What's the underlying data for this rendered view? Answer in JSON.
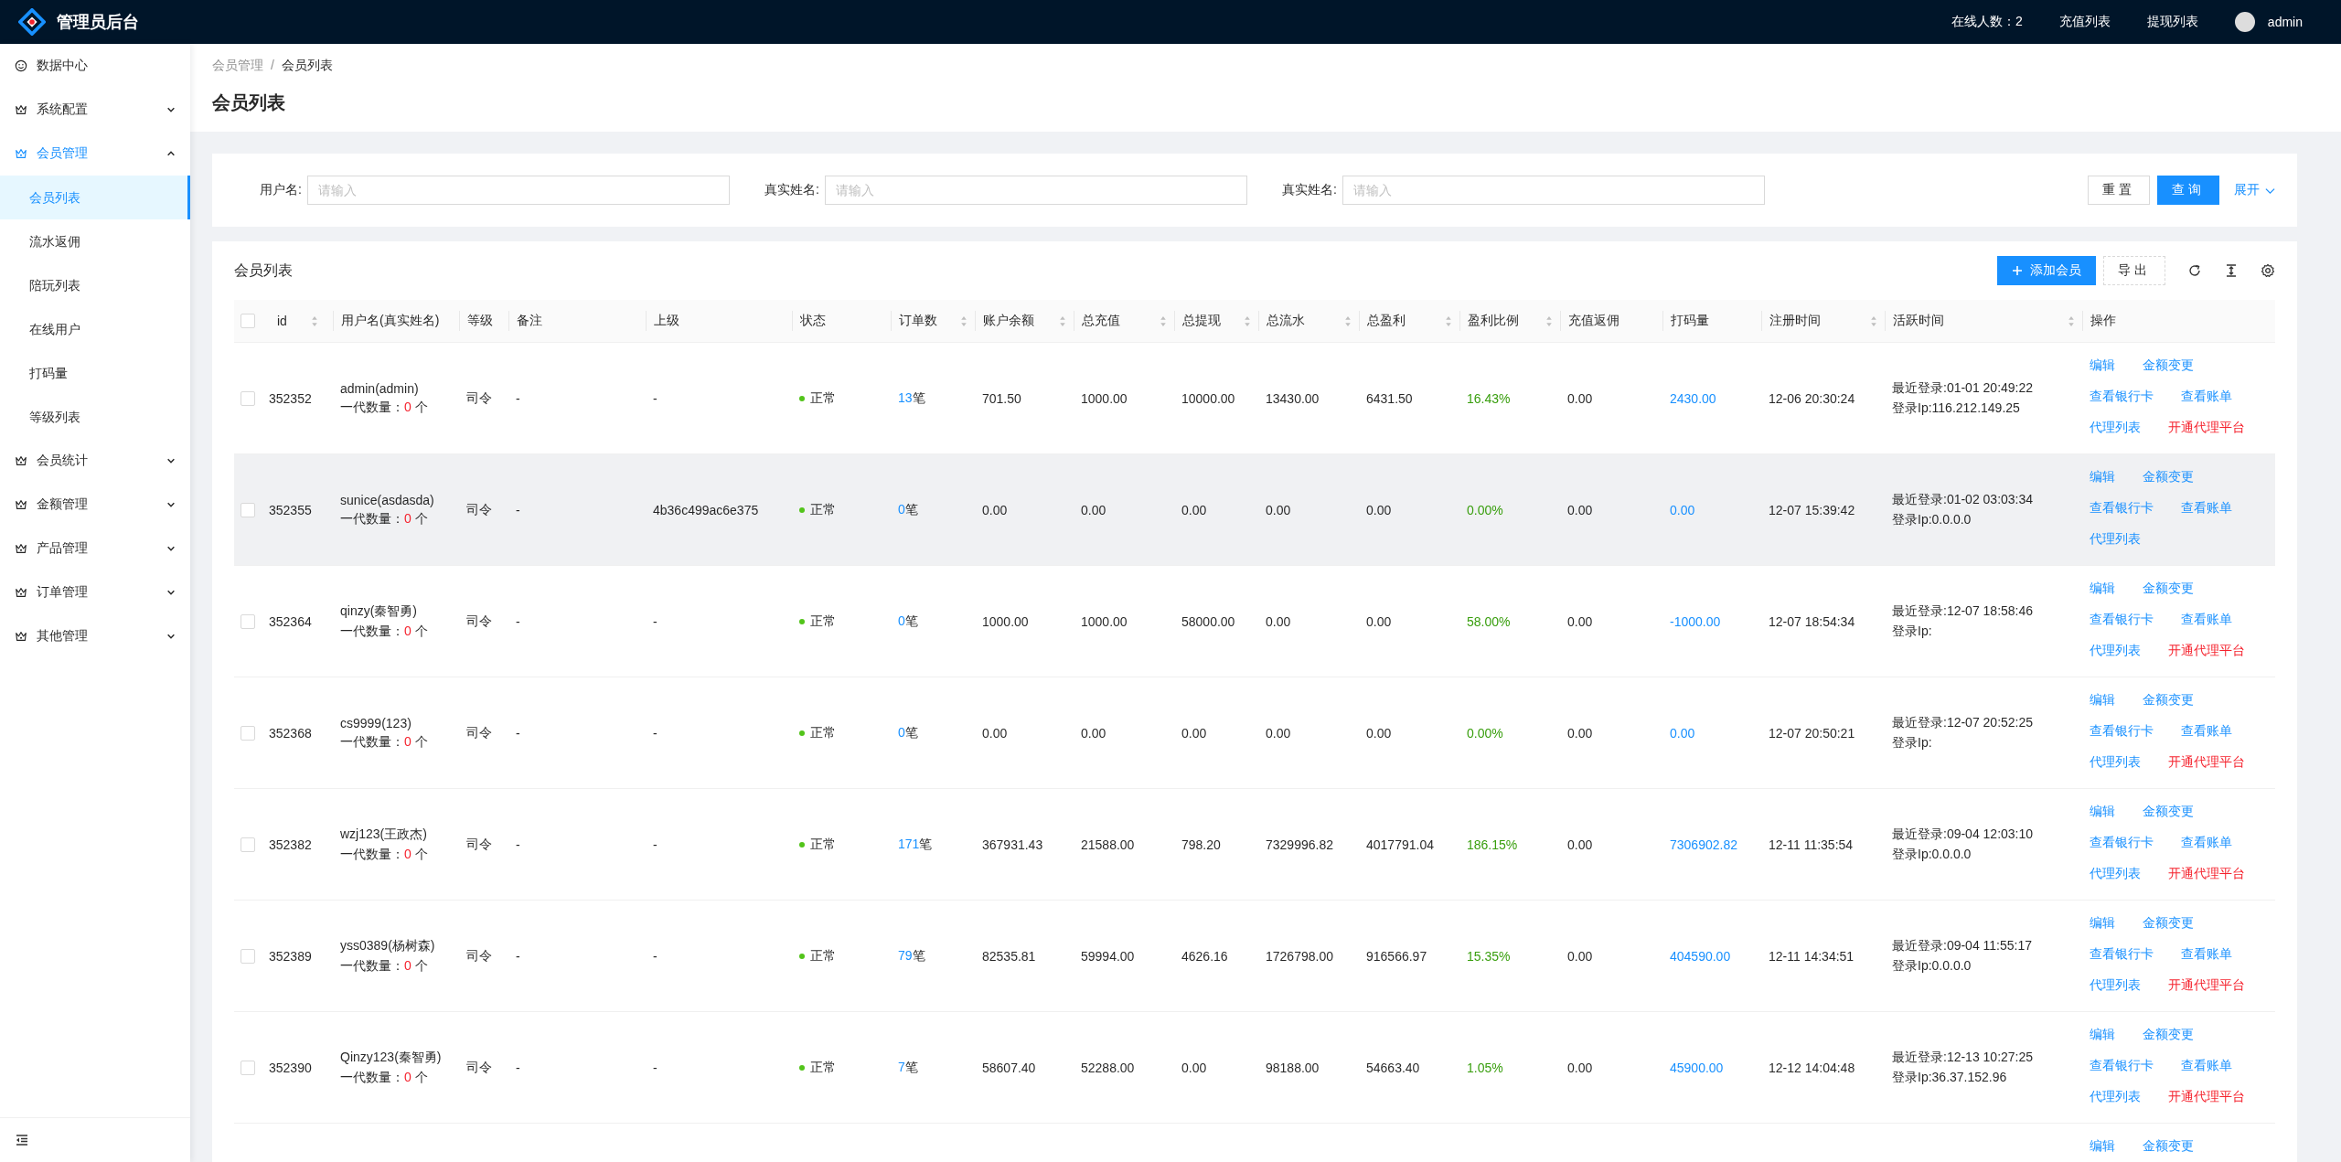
{
  "header": {
    "title": "管理员后台",
    "online_count": "在线人数：2",
    "links": [
      "充值列表",
      "提现列表"
    ],
    "user": "admin"
  },
  "sidebar": {
    "items": [
      {
        "label": "数据中心",
        "kind": "link"
      },
      {
        "label": "系统配置",
        "kind": "submenu",
        "expanded": false
      },
      {
        "label": "会员管理",
        "kind": "submenu",
        "expanded": true,
        "children": [
          {
            "label": "会员列表",
            "selected": true
          },
          {
            "label": "流水返佣",
            "selected": false
          },
          {
            "label": "陪玩列表",
            "selected": false
          },
          {
            "label": "在线用户",
            "selected": false
          },
          {
            "label": "打码量",
            "selected": false
          },
          {
            "label": "等级列表",
            "selected": false
          }
        ]
      },
      {
        "label": "会员统计",
        "kind": "submenu",
        "expanded": false
      },
      {
        "label": "金额管理",
        "kind": "submenu",
        "expanded": false
      },
      {
        "label": "产品管理",
        "kind": "submenu",
        "expanded": false
      },
      {
        "label": "订单管理",
        "kind": "submenu",
        "expanded": false
      },
      {
        "label": "其他管理",
        "kind": "submenu",
        "expanded": false
      }
    ]
  },
  "breadcrumb": {
    "items": [
      "会员管理",
      "会员列表"
    ],
    "separator": "/"
  },
  "page_title": "会员列表",
  "search": {
    "fields": [
      {
        "label": "用户名:",
        "placeholder": "请输入"
      },
      {
        "label": "真实姓名:",
        "placeholder": "请输入"
      },
      {
        "label": "真实姓名:",
        "placeholder": "请输入"
      }
    ],
    "buttons": [
      {
        "label": "重置",
        "kind": "default"
      },
      {
        "label": "查询",
        "kind": "primary"
      }
    ],
    "expand": "展开"
  },
  "table": {
    "title": "会员列表",
    "add_button": "添加会员",
    "export_button": "导出",
    "all_selected": false,
    "columns": [
      {
        "label": "id",
        "sortable": true
      },
      {
        "label": "用户名(真实姓名)",
        "sortable": false
      },
      {
        "label": "等级",
        "sortable": false
      },
      {
        "label": "备注",
        "sortable": false
      },
      {
        "label": "上级",
        "sortable": false
      },
      {
        "label": "状态",
        "sortable": false
      },
      {
        "label": "订单数",
        "sortable": true
      },
      {
        "label": "账户余额",
        "sortable": true
      },
      {
        "label": "总充值",
        "sortable": true
      },
      {
        "label": "总提现",
        "sortable": true
      },
      {
        "label": "总流水",
        "sortable": true
      },
      {
        "label": "总盈利",
        "sortable": true
      },
      {
        "label": "盈利比例",
        "sortable": true
      },
      {
        "label": "充值返佣",
        "sortable": false
      },
      {
        "label": "打码量",
        "sortable": false
      },
      {
        "label": "注册时间",
        "sortable": true
      },
      {
        "label": "活跃时间",
        "sortable": true
      },
      {
        "label": "操作",
        "sortable": false
      }
    ],
    "rows": [
      {
        "selected": false,
        "highlighted": false,
        "id": "352352",
        "user": "admin(admin)",
        "sub": {
          "label": "一代数量：",
          "count": "0",
          "unit": "个"
        },
        "level": "司令",
        "remark": "-",
        "parent": "-",
        "status": {
          "text": "正常",
          "color": "#52c41a"
        },
        "orders": {
          "count": "13",
          "unit": "笔"
        },
        "balance": "701.50",
        "recharge": "1000.00",
        "withdraw": "10000.00",
        "turnover": "13430.00",
        "profit": "6431.50",
        "ratio": "16.43%",
        "rebate": "0.00",
        "betting": "2430.00",
        "registered": "12-06 20:30:24",
        "last_login": "最近登录:01-01 20:49:22",
        "login_ip": "登录Ip:116.212.149.25",
        "actions": [
          {
            "label": "编辑",
            "kind": "link"
          },
          {
            "label": "金额变更",
            "kind": "link"
          },
          {
            "label": "查看银行卡",
            "kind": "link"
          },
          {
            "label": "查看账单",
            "kind": "link"
          },
          {
            "label": "代理列表",
            "kind": "link"
          },
          {
            "label": "开通代理平台",
            "kind": "danger"
          }
        ]
      },
      {
        "selected": false,
        "highlighted": true,
        "id": "352355",
        "user": "sunice(asdasda)",
        "sub": {
          "label": "一代数量：",
          "count": "0",
          "unit": "个"
        },
        "level": "司令",
        "remark": "-",
        "parent": "4b36c499ac6e375",
        "status": {
          "text": "正常",
          "color": "#52c41a"
        },
        "orders": {
          "count": "0",
          "unit": "笔"
        },
        "balance": "0.00",
        "recharge": "0.00",
        "withdraw": "0.00",
        "turnover": "0.00",
        "profit": "0.00",
        "ratio": "0.00%",
        "rebate": "0.00",
        "betting": "0.00",
        "registered": "12-07 15:39:42",
        "last_login": "最近登录:01-02 03:03:34",
        "login_ip": "登录Ip:0.0.0.0",
        "actions": [
          {
            "label": "编辑",
            "kind": "link"
          },
          {
            "label": "金额变更",
            "kind": "link"
          },
          {
            "label": "查看银行卡",
            "kind": "link"
          },
          {
            "label": "查看账单",
            "kind": "link"
          },
          {
            "label": "代理列表",
            "kind": "link"
          }
        ]
      },
      {
        "selected": false,
        "highlighted": false,
        "id": "352364",
        "user": "qinzy(秦智勇)",
        "sub": {
          "label": "一代数量：",
          "count": "0",
          "unit": "个"
        },
        "level": "司令",
        "remark": "-",
        "parent": "-",
        "status": {
          "text": "正常",
          "color": "#52c41a"
        },
        "orders": {
          "count": "0",
          "unit": "笔"
        },
        "balance": "1000.00",
        "recharge": "1000.00",
        "withdraw": "58000.00",
        "turnover": "0.00",
        "profit": "0.00",
        "ratio": "58.00%",
        "rebate": "0.00",
        "betting": "-1000.00",
        "registered": "12-07 18:54:34",
        "last_login": "最近登录:12-07 18:58:46",
        "login_ip": "登录Ip:",
        "actions": [
          {
            "label": "编辑",
            "kind": "link"
          },
          {
            "label": "金额变更",
            "kind": "link"
          },
          {
            "label": "查看银行卡",
            "kind": "link"
          },
          {
            "label": "查看账单",
            "kind": "link"
          },
          {
            "label": "代理列表",
            "kind": "link"
          },
          {
            "label": "开通代理平台",
            "kind": "danger"
          }
        ]
      },
      {
        "selected": false,
        "highlighted": false,
        "id": "352368",
        "user": "cs9999(123)",
        "sub": {
          "label": "一代数量：",
          "count": "0",
          "unit": "个"
        },
        "level": "司令",
        "remark": "-",
        "parent": "-",
        "status": {
          "text": "正常",
          "color": "#52c41a"
        },
        "orders": {
          "count": "0",
          "unit": "笔"
        },
        "balance": "0.00",
        "recharge": "0.00",
        "withdraw": "0.00",
        "turnover": "0.00",
        "profit": "0.00",
        "ratio": "0.00%",
        "rebate": "0.00",
        "betting": "0.00",
        "registered": "12-07 20:50:21",
        "last_login": "最近登录:12-07 20:52:25",
        "login_ip": "登录Ip:",
        "actions": [
          {
            "label": "编辑",
            "kind": "link"
          },
          {
            "label": "金额变更",
            "kind": "link"
          },
          {
            "label": "查看银行卡",
            "kind": "link"
          },
          {
            "label": "查看账单",
            "kind": "link"
          },
          {
            "label": "代理列表",
            "kind": "link"
          },
          {
            "label": "开通代理平台",
            "kind": "danger"
          }
        ]
      },
      {
        "selected": false,
        "highlighted": false,
        "id": "352382",
        "user": "wzj123(王政杰)",
        "sub": {
          "label": "一代数量：",
          "count": "0",
          "unit": "个"
        },
        "level": "司令",
        "remark": "-",
        "parent": "-",
        "status": {
          "text": "正常",
          "color": "#52c41a"
        },
        "orders": {
          "count": "171",
          "unit": "笔"
        },
        "balance": "367931.43",
        "recharge": "21588.00",
        "withdraw": "798.20",
        "turnover": "7329996.82",
        "profit": "4017791.04",
        "ratio": "186.15%",
        "rebate": "0.00",
        "betting": "7306902.82",
        "registered": "12-11 11:35:54",
        "last_login": "最近登录:09-04 12:03:10",
        "login_ip": "登录Ip:0.0.0.0",
        "actions": [
          {
            "label": "编辑",
            "kind": "link"
          },
          {
            "label": "金额变更",
            "kind": "link"
          },
          {
            "label": "查看银行卡",
            "kind": "link"
          },
          {
            "label": "查看账单",
            "kind": "link"
          },
          {
            "label": "代理列表",
            "kind": "link"
          },
          {
            "label": "开通代理平台",
            "kind": "danger"
          }
        ]
      },
      {
        "selected": false,
        "highlighted": false,
        "id": "352389",
        "user": "yss0389(杨树森)",
        "sub": {
          "label": "一代数量：",
          "count": "0",
          "unit": "个"
        },
        "level": "司令",
        "remark": "-",
        "parent": "-",
        "status": {
          "text": "正常",
          "color": "#52c41a"
        },
        "orders": {
          "count": "79",
          "unit": "笔"
        },
        "balance": "82535.81",
        "recharge": "59994.00",
        "withdraw": "4626.16",
        "turnover": "1726798.00",
        "profit": "916566.97",
        "ratio": "15.35%",
        "rebate": "0.00",
        "betting": "404590.00",
        "registered": "12-11 14:34:51",
        "last_login": "最近登录:09-04 11:55:17",
        "login_ip": "登录Ip:0.0.0.0",
        "actions": [
          {
            "label": "编辑",
            "kind": "link"
          },
          {
            "label": "金额变更",
            "kind": "link"
          },
          {
            "label": "查看银行卡",
            "kind": "link"
          },
          {
            "label": "查看账单",
            "kind": "link"
          },
          {
            "label": "代理列表",
            "kind": "link"
          },
          {
            "label": "开通代理平台",
            "kind": "danger"
          }
        ]
      },
      {
        "selected": false,
        "highlighted": false,
        "id": "352390",
        "user": "Qinzy123(秦智勇)",
        "sub": {
          "label": "一代数量：",
          "count": "0",
          "unit": "个"
        },
        "level": "司令",
        "remark": "-",
        "parent": "-",
        "status": {
          "text": "正常",
          "color": "#52c41a"
        },
        "orders": {
          "count": "7",
          "unit": "笔"
        },
        "balance": "58607.40",
        "recharge": "52288.00",
        "withdraw": "0.00",
        "turnover": "98188.00",
        "profit": "54663.40",
        "ratio": "1.05%",
        "rebate": "0.00",
        "betting": "45900.00",
        "registered": "12-12 14:04:48",
        "last_login": "最近登录:12-13 10:27:25",
        "login_ip": "登录Ip:36.37.152.96",
        "actions": [
          {
            "label": "编辑",
            "kind": "link"
          },
          {
            "label": "金额变更",
            "kind": "link"
          },
          {
            "label": "查看银行卡",
            "kind": "link"
          },
          {
            "label": "查看账单",
            "kind": "link"
          },
          {
            "label": "代理列表",
            "kind": "link"
          },
          {
            "label": "开通代理平台",
            "kind": "danger"
          }
        ]
      },
      {
        "actions": [
          {
            "label": "编辑",
            "kind": "link"
          },
          {
            "label": "金额变更",
            "kind": "link"
          }
        ]
      }
    ]
  }
}
